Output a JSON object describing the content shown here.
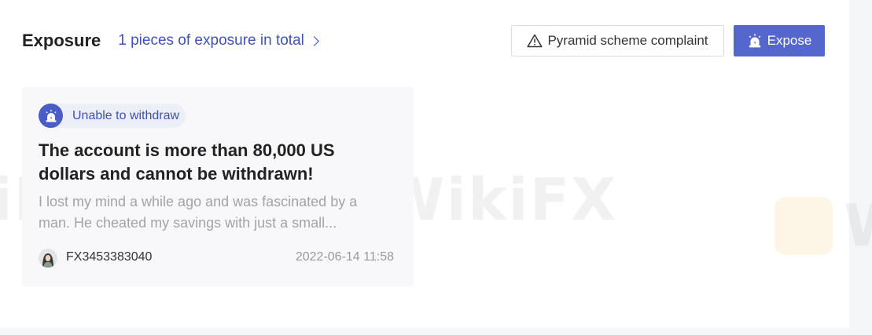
{
  "header": {
    "title": "Exposure",
    "total_link": "1 pieces of exposure in total"
  },
  "actions": {
    "complaint_label": "Pyramid scheme complaint",
    "expose_label": "Expose"
  },
  "watermark": {
    "text_left": "iFX",
    "text_center": "WikiFX",
    "text_right": "W"
  },
  "card": {
    "tag_label": "Unable to withdraw",
    "title": "The account is more than 80,000 US dollars and cannot be withdrawn!",
    "excerpt": "I lost my mind a while ago and was fascinated by a man. He cheated my savings with just a small...",
    "user": "FX3453383040",
    "date": "2022-06-14 11:58"
  },
  "icons": {
    "complaint": "warning-triangle-icon",
    "expose": "alarm-icon",
    "tag": "alarm-icon",
    "link": "chevron-right-icon"
  },
  "colors": {
    "accent": "#3f51b5",
    "button_primary": "#5566cc",
    "tag_bg": "#eceef8"
  }
}
